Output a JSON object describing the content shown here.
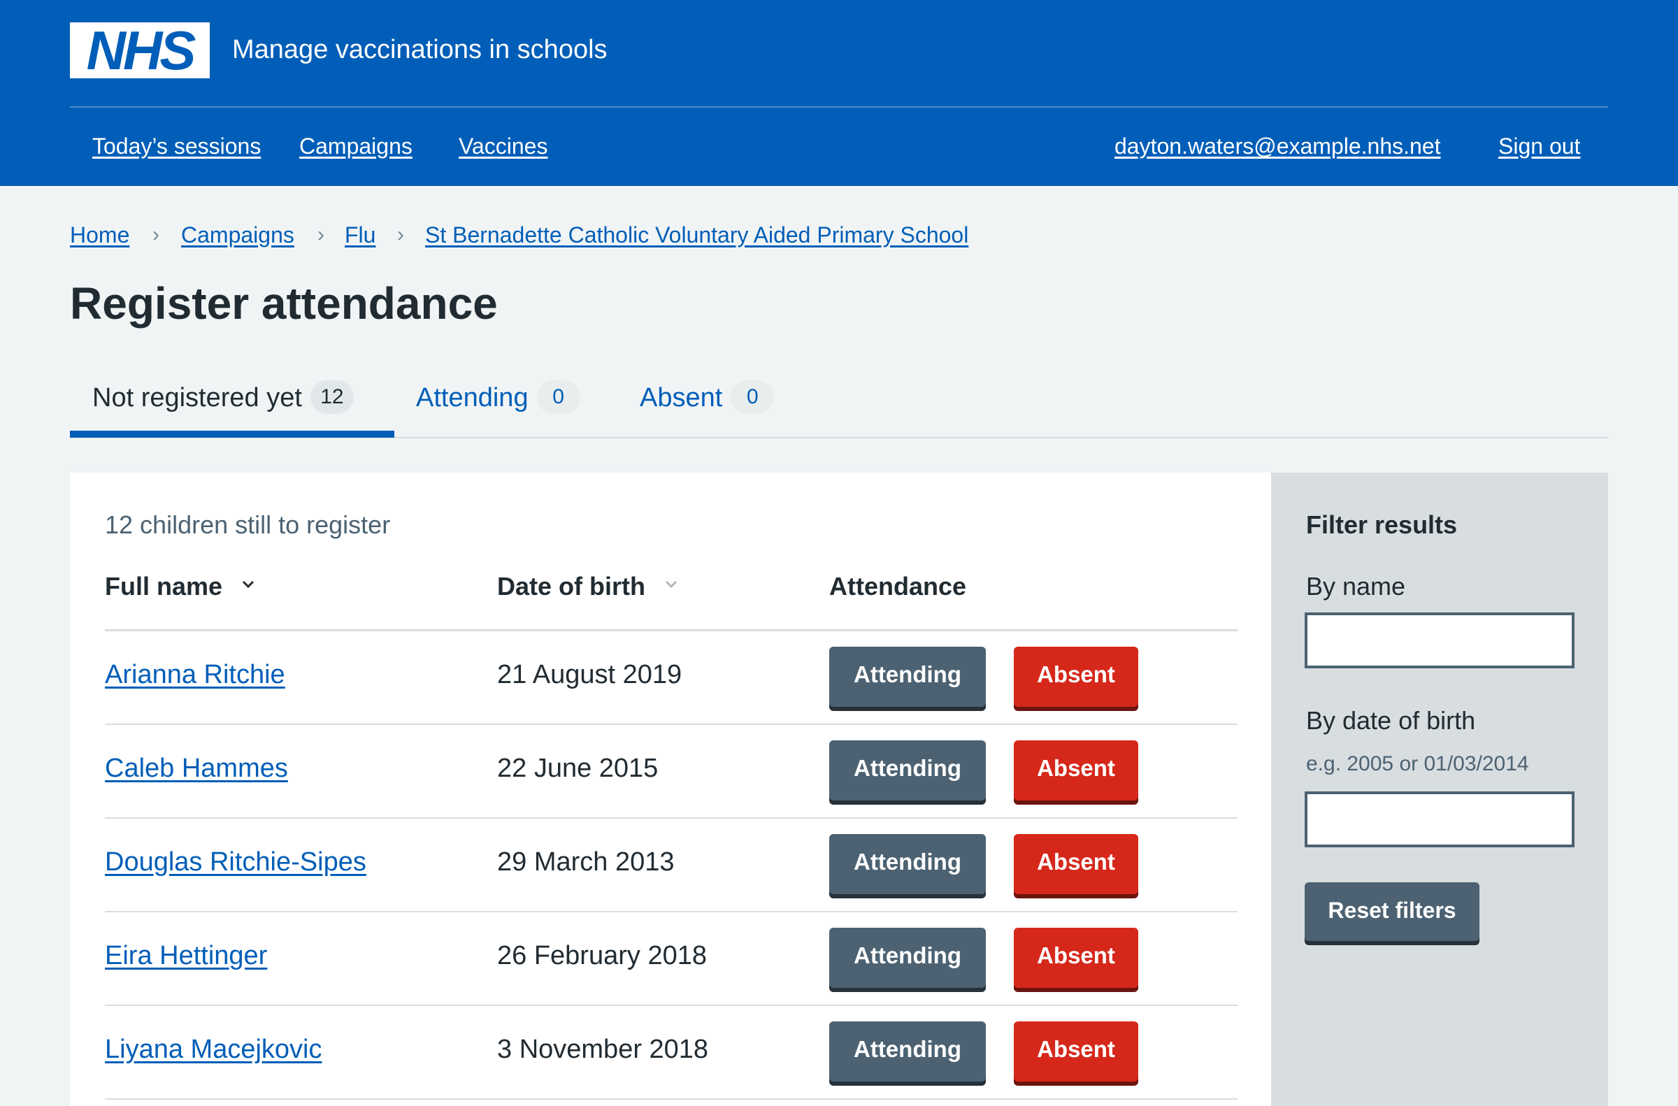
{
  "header": {
    "logo_text": "NHS",
    "service_name": "Manage vaccinations in schools",
    "nav": [
      {
        "label": "Today’s sessions"
      },
      {
        "label": "Campaigns"
      },
      {
        "label": "Vaccines"
      }
    ],
    "account": {
      "email": "dayton.waters@example.nhs.net",
      "sign_out": "Sign out"
    }
  },
  "breadcrumb": [
    {
      "label": "Home"
    },
    {
      "label": "Campaigns"
    },
    {
      "label": "Flu"
    },
    {
      "label": "St Bernadette Catholic Voluntary Aided Primary School"
    }
  ],
  "page": {
    "title": "Register attendance"
  },
  "tabs": [
    {
      "label": "Not registered yet",
      "count": "12",
      "active": true
    },
    {
      "label": "Attending",
      "count": "0",
      "active": false
    },
    {
      "label": "Absent",
      "count": "0",
      "active": false
    }
  ],
  "table": {
    "caption": "12 children still to register",
    "columns": {
      "name": "Full name",
      "dob": "Date of birth",
      "attendance": "Attendance"
    },
    "rows": [
      {
        "name": "Arianna Ritchie",
        "dob": "21 August 2019",
        "attending_label": "Attending",
        "absent_label": "Absent"
      },
      {
        "name": "Caleb Hammes",
        "dob": "22 June 2015",
        "attending_label": "Attending",
        "absent_label": "Absent"
      },
      {
        "name": "Douglas Ritchie-Sipes",
        "dob": "29 March 2013",
        "attending_label": "Attending",
        "absent_label": "Absent"
      },
      {
        "name": "Eira Hettinger",
        "dob": "26 February 2018",
        "attending_label": "Attending",
        "absent_label": "Absent"
      },
      {
        "name": "Liyana Macejkovic",
        "dob": "3 November 2018",
        "attending_label": "Attending",
        "absent_label": "Absent"
      }
    ]
  },
  "filter": {
    "title": "Filter results",
    "by_name_label": "By name",
    "by_name_value": "",
    "by_dob_label": "By date of birth",
    "by_dob_hint": "e.g. 2005 or 01/03/2014",
    "by_dob_value": "",
    "reset_label": "Reset filters"
  },
  "colors": {
    "nhs_blue": "#005eb8",
    "secondary_button": "#4c6272",
    "warning_red": "#d5281b",
    "page_background": "#f0f4f5",
    "filter_background": "#d8dde0"
  },
  "icons": {
    "sort_active": "chevron-down-icon",
    "sort_inactive": "chevron-down-icon",
    "breadcrumb_separator": "chevron-right-icon"
  }
}
